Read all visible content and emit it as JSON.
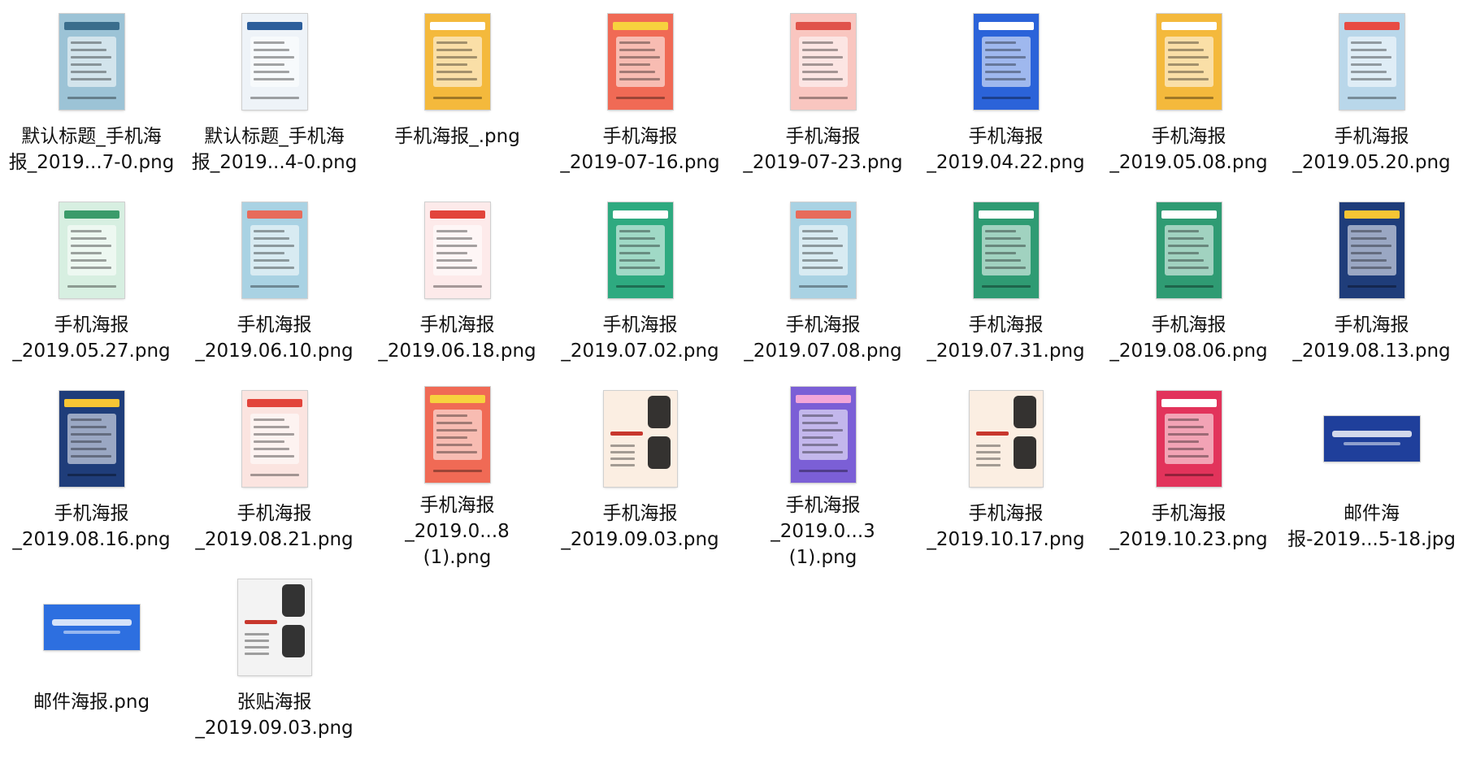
{
  "files": [
    {
      "label": "默认标题_手机海\n报_2019...7-0.png",
      "icon": "poster-thumbnail-icon",
      "bg": "#9cc3d6",
      "accent": "#3a6d8c",
      "kind": "poster"
    },
    {
      "label": "默认标题_手机海\n报_2019...4-0.png",
      "icon": "poster-thumbnail-icon",
      "bg": "#eef3f8",
      "accent": "#2c5e9b",
      "kind": "poster"
    },
    {
      "label": "手机海报_.png",
      "icon": "poster-thumbnail-icon",
      "bg": "#f4b93c",
      "accent": "#ffffff",
      "kind": "poster"
    },
    {
      "label": "手机海报\n_2019-07-16.png",
      "icon": "poster-thumbnail-icon",
      "bg": "#f06a55",
      "accent": "#f7d23e",
      "kind": "poster"
    },
    {
      "label": "手机海报\n_2019-07-23.png",
      "icon": "poster-thumbnail-icon",
      "bg": "#f9c6c0",
      "accent": "#e0534b",
      "kind": "poster"
    },
    {
      "label": "手机海报\n_2019.04.22.png",
      "icon": "poster-thumbnail-icon",
      "bg": "#2b63d9",
      "accent": "#ffffff",
      "kind": "poster"
    },
    {
      "label": "手机海报\n_2019.05.08.png",
      "icon": "poster-thumbnail-icon",
      "bg": "#f4b93c",
      "accent": "#ffffff",
      "kind": "poster"
    },
    {
      "label": "手机海报\n_2019.05.20.png",
      "icon": "poster-thumbnail-icon",
      "bg": "#b9d7ea",
      "accent": "#e84b43",
      "kind": "poster"
    },
    {
      "label": "手机海报\n_2019.05.27.png",
      "icon": "poster-thumbnail-icon",
      "bg": "#d7efe1",
      "accent": "#3a9b6a",
      "kind": "poster"
    },
    {
      "label": "手机海报\n_2019.06.10.png",
      "icon": "poster-thumbnail-icon",
      "bg": "#a9d2e3",
      "accent": "#e76b5b",
      "kind": "poster"
    },
    {
      "label": "手机海报\n_2019.06.18.png",
      "icon": "poster-thumbnail-icon",
      "bg": "#fdeaea",
      "accent": "#e2443b",
      "kind": "poster"
    },
    {
      "label": "手机海报\n_2019.07.02.png",
      "icon": "poster-thumbnail-icon",
      "bg": "#2eaa80",
      "accent": "#ffffff",
      "kind": "poster"
    },
    {
      "label": "手机海报\n_2019.07.08.png",
      "icon": "poster-thumbnail-icon",
      "bg": "#a9d2e3",
      "accent": "#e76b5b",
      "kind": "poster"
    },
    {
      "label": "手机海报\n_2019.07.31.png",
      "icon": "poster-thumbnail-icon",
      "bg": "#2f9b73",
      "accent": "#ffffff",
      "kind": "poster"
    },
    {
      "label": "手机海报\n_2019.08.06.png",
      "icon": "poster-thumbnail-icon",
      "bg": "#2f9b73",
      "accent": "#ffffff",
      "kind": "poster"
    },
    {
      "label": "手机海报\n_2019.08.13.png",
      "icon": "poster-thumbnail-icon",
      "bg": "#1f3d7a",
      "accent": "#f7c534",
      "kind": "poster"
    },
    {
      "label": "手机海报\n_2019.08.16.png",
      "icon": "poster-thumbnail-icon",
      "bg": "#1f3d7a",
      "accent": "#f7c534",
      "kind": "poster"
    },
    {
      "label": "手机海报\n_2019.08.21.png",
      "icon": "poster-thumbnail-icon",
      "bg": "#fbe4e0",
      "accent": "#e2443b",
      "kind": "poster"
    },
    {
      "label": "手机海报\n_2019.0...8 (1).png",
      "icon": "poster-thumbnail-icon",
      "bg": "#f06a55",
      "accent": "#f7d23e",
      "kind": "poster"
    },
    {
      "label": "手机海报\n_2019.09.03.png",
      "icon": "poster-thumbnail-icon",
      "bg": "#fbeee2",
      "accent": "#c8372d",
      "kind": "char"
    },
    {
      "label": "手机海报\n_2019.0...3 (1).png",
      "icon": "poster-thumbnail-icon",
      "bg": "#7b5fd6",
      "accent": "#f3a6d9",
      "kind": "poster"
    },
    {
      "label": "手机海报\n_2019.10.17.png",
      "icon": "poster-thumbnail-icon",
      "bg": "#fbeee2",
      "accent": "#c8372d",
      "kind": "char"
    },
    {
      "label": "手机海报\n_2019.10.23.png",
      "icon": "poster-thumbnail-icon",
      "bg": "#e2335b",
      "accent": "#ffffff",
      "kind": "poster"
    },
    {
      "label": "邮件海\n报-2019...5-18.jpg",
      "icon": "email-banner-thumbnail-icon",
      "bg": "#1f3f9b",
      "accent": "#ffffff",
      "kind": "wide"
    },
    {
      "label": "邮件海报.png",
      "icon": "email-banner-thumbnail-icon",
      "bg": "#2d6fe0",
      "accent": "#ffffff",
      "kind": "wide"
    },
    {
      "label": "张贴海报\n_2019.09.03.png",
      "icon": "poster-thumbnail-icon",
      "bg": "#f3f3f3",
      "accent": "#c8372d",
      "kind": "char"
    }
  ]
}
